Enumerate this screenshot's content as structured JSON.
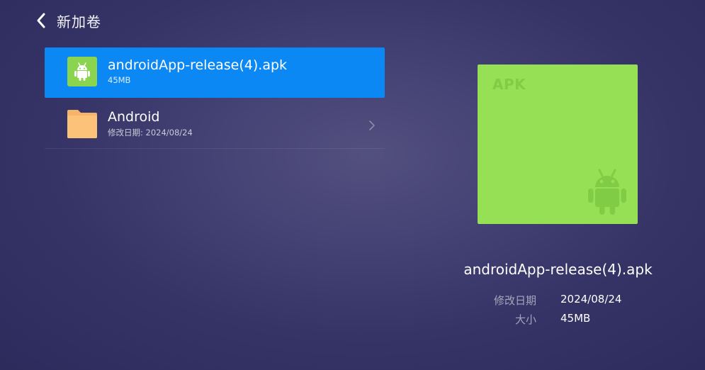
{
  "header": {
    "back_icon": "chevron-left-icon",
    "title": "新加卷"
  },
  "files": [
    {
      "name": "androidApp-release(4).apk",
      "meta": "45MB",
      "icon": "android-apk-icon",
      "selected": true
    },
    {
      "name": "Android",
      "meta": "修改日期: 2024/08/24",
      "icon": "folder-icon",
      "selected": false
    }
  ],
  "preview": {
    "type_label": "APK",
    "icon": "android-robot-icon"
  },
  "details": {
    "name": "androidApp-release(4).apk",
    "modified_label": "修改日期",
    "modified_value": "2024/08/24",
    "size_label": "大小",
    "size_value": "45MB"
  },
  "colors": {
    "selection": "#0c88f4",
    "apk_green": "#95e055",
    "folder_orange": "#fcc27a"
  }
}
